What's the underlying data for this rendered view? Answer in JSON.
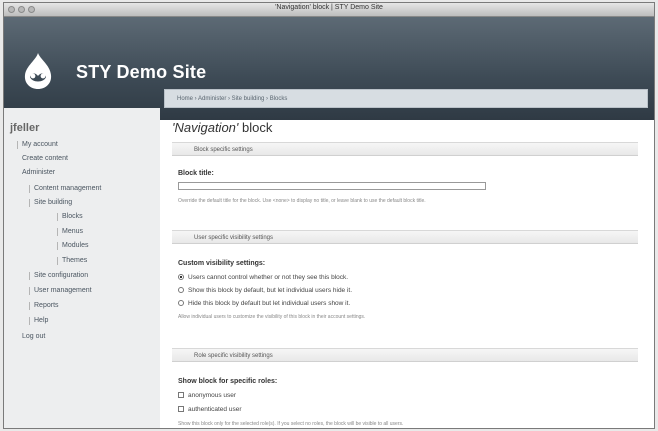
{
  "window": {
    "title": "'Navigation' block | STY Demo Site"
  },
  "site": {
    "name": "STY Demo Site"
  },
  "breadcrumb": "Home › Administer › Site building › Blocks",
  "sidebar": {
    "user": "jfeller",
    "items": [
      {
        "label": "My account"
      },
      {
        "label": "Create content"
      },
      {
        "label": "Administer"
      },
      {
        "label": "Content management"
      },
      {
        "label": "Site building"
      },
      {
        "label": "Blocks"
      },
      {
        "label": "Menus"
      },
      {
        "label": "Modules"
      },
      {
        "label": "Themes"
      },
      {
        "label": "Site configuration"
      },
      {
        "label": "User management"
      },
      {
        "label": "Reports"
      },
      {
        "label": "Help"
      },
      {
        "label": "Log out"
      }
    ]
  },
  "main": {
    "title_quoted": "'Navigation'",
    "title_rest": " block",
    "block_section": "Block specific settings",
    "block_title_label": "Block title:",
    "block_title_value": "",
    "block_title_desc": "Override the default title for the block. Use <none> to display no title, or leave blank to use the default block title.",
    "user_section": "User specific visibility settings",
    "custom_label": "Custom visibility settings:",
    "custom_options": [
      "Users cannot control whether or not they see this block.",
      "Show this block by default, but let individual users hide it.",
      "Hide this block by default but let individual users show it."
    ],
    "custom_desc": "Allow individual users to customize the visibility of this block in their account settings.",
    "role_section": "Role specific visibility settings",
    "roles_label": "Show block for specific roles:",
    "roles": [
      "anonymous user",
      "authenticated user"
    ],
    "roles_desc": "Show this block only for the selected role(s). If you select no roles, the block will be visible to all users."
  }
}
